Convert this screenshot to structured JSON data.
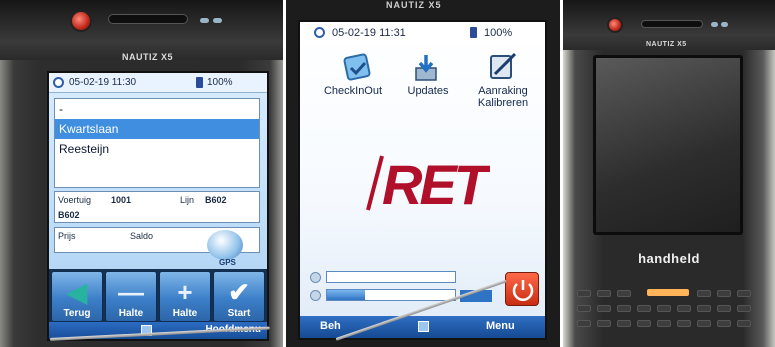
{
  "left_device": {
    "brand": "NAUTIZ X5",
    "status": {
      "datetime": "05-02-19 11:30",
      "battery": "100%"
    },
    "list": {
      "blank_item": "-",
      "selected": "Kwartslaan",
      "next": "Reesteijn"
    },
    "vehicle": {
      "voertuig_label": "Voertuig",
      "voertuig_value": "1001",
      "lijn_label": "Lijn",
      "lijn_value": "B602",
      "route": "B602"
    },
    "prices": {
      "prijs_label": "Prijs",
      "saldo_label": "Saldo"
    },
    "gps_label": "GPS",
    "buttons": [
      {
        "label": "Terug",
        "icon": "arrow-left-icon"
      },
      {
        "label": "Halte",
        "icon": "minus-icon"
      },
      {
        "label": "Halte",
        "icon": "plus-icon"
      },
      {
        "label": "Start",
        "icon": "checkmark-icon"
      }
    ],
    "taskbar_menu": "Hoofdmenu"
  },
  "middle_device": {
    "brand": "NAUTIZ X5",
    "status": {
      "datetime": "05-02-19 11:31",
      "battery": "100%"
    },
    "apps": [
      {
        "label": "CheckInOut",
        "icon": "checkinout-icon"
      },
      {
        "label": "Updates",
        "icon": "download-icon"
      },
      {
        "label": "Aanraking Kalibreren",
        "icon": "calibrate-icon"
      }
    ],
    "logo_text": "RET",
    "taskbar_left": "Beh",
    "taskbar_right": "Menu",
    "sliders": {
      "volume": 0.0,
      "brightness": 0.3
    }
  },
  "right_device": {
    "brand": "NAUTIZ X5",
    "label": "handheld"
  },
  "colors": {
    "screen_blue": "#bcdcf8",
    "accent_blue": "#3f8ee0",
    "ret_red": "#b0102a",
    "power_red": "#c72d12"
  }
}
